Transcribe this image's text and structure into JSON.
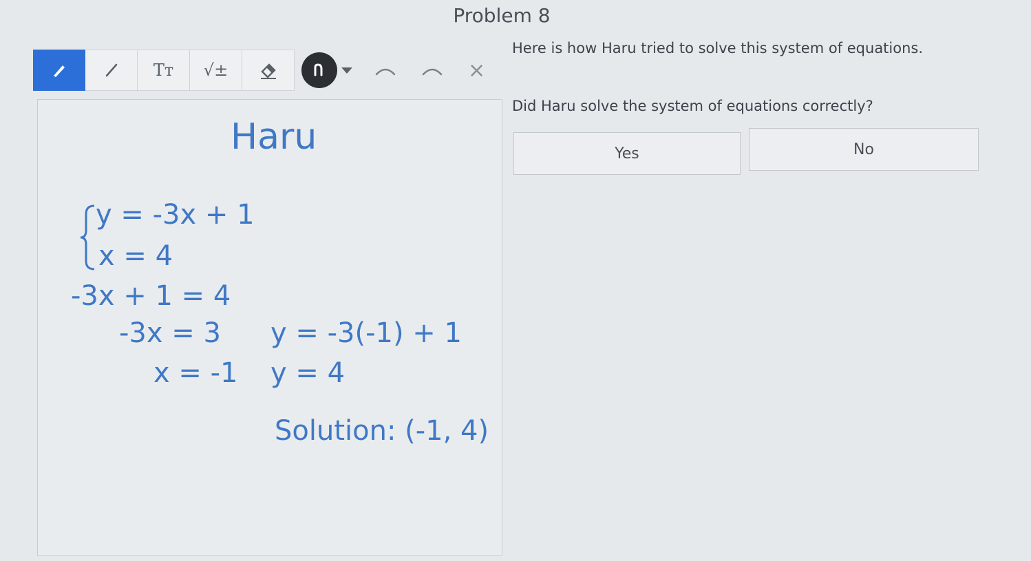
{
  "header": {
    "title": "Problem 8"
  },
  "toolbar": {
    "tools": [
      {
        "name": "pen",
        "icon": "pencil-icon",
        "active": true
      },
      {
        "name": "line",
        "icon": "line-icon"
      },
      {
        "name": "text",
        "icon": "text-icon",
        "label": "Tт"
      },
      {
        "name": "math",
        "icon": "sqrt-icon",
        "label": "√±"
      },
      {
        "name": "eraser",
        "icon": "eraser-icon"
      }
    ],
    "lasso_icon": "lasso-icon",
    "undo_icon": "undo-icon",
    "redo_icon": "redo-icon",
    "clear_label": "×"
  },
  "canvas": {
    "name": "Haru",
    "lines": [
      "y = -3x + 1",
      "x = 4",
      "-3x + 1 = 4",
      "-3x = 3",
      "y = -3(-1) + 1",
      "x = -1",
      "y = 4",
      "Solution: (-1, 4)"
    ]
  },
  "question": {
    "intro": "Here is how Haru tried to solve this system of equations.",
    "prompt": "Did Haru solve the system of equations correctly?",
    "options": [
      "Yes",
      "No"
    ]
  },
  "colors": {
    "accent": "#2c6fd8",
    "handwriting": "#3f78c6"
  }
}
